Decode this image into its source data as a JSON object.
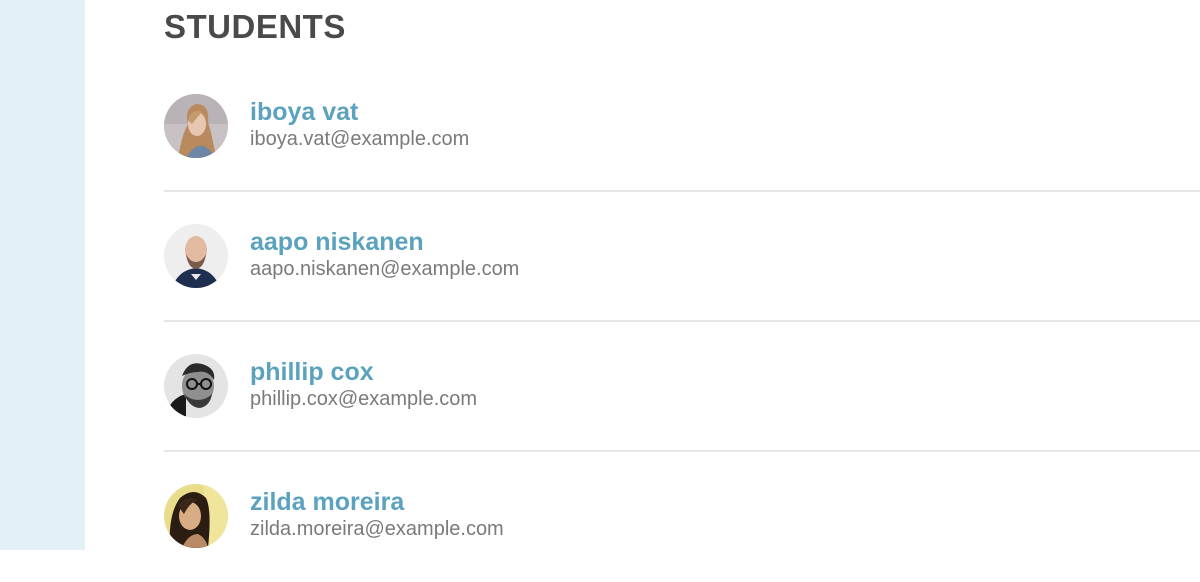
{
  "page": {
    "section_title": "STUDENTS"
  },
  "students": [
    {
      "name": "iboya vat",
      "email": "iboya.vat@example.com",
      "avatar": "woman-blonde-photo"
    },
    {
      "name": "aapo niskanen",
      "email": "aapo.niskanen@example.com",
      "avatar": "man-bald-beard-photo"
    },
    {
      "name": "phillip cox",
      "email": "phillip.cox@example.com",
      "avatar": "man-glasses-bw-photo"
    },
    {
      "name": "zilda moreira",
      "email": "zilda.moreira@example.com",
      "avatar": "woman-dark-hair-photo"
    }
  ],
  "colors": {
    "sidebar_bg": "#e3f0f6",
    "name_link": "#5aa2bd",
    "email_text": "#7a7a7a",
    "title_text": "#4a4a4a",
    "divider": "#e6e6e6"
  }
}
